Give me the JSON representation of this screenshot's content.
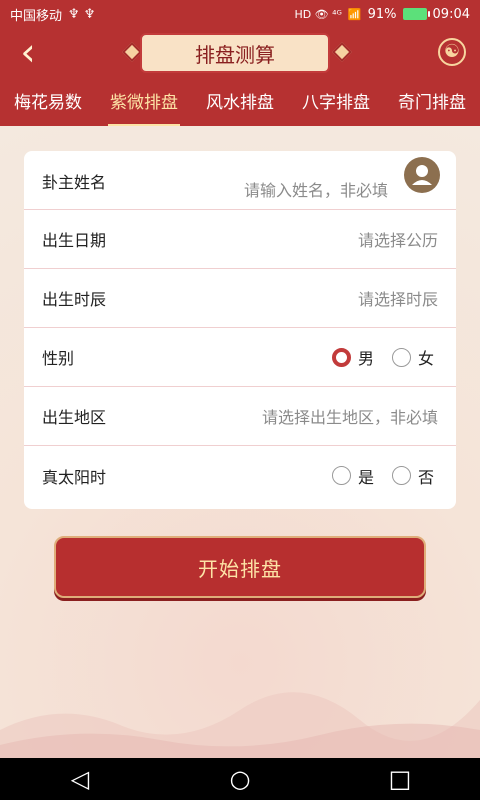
{
  "status_bar": {
    "carrier": "中国移动",
    "left_symbols": "♆ ♆",
    "right_symbols": "HD 👁 ⁴ᴳ",
    "signal": "📶",
    "battery_percent": "91%",
    "time": "09:04"
  },
  "header": {
    "title": "排盘测算"
  },
  "tabs": [
    {
      "label": "梅花易数"
    },
    {
      "label": "紫微排盘"
    },
    {
      "label": "风水排盘"
    },
    {
      "label": "八字排盘"
    },
    {
      "label": "奇门排盘"
    }
  ],
  "form": {
    "name_label": "卦主姓名",
    "name_placeholder": "请输入姓名，非必填",
    "birth_date_label": "出生日期",
    "birth_date_placeholder": "请选择公历",
    "birth_time_label": "出生时辰",
    "birth_time_placeholder": "请选择时辰",
    "gender_label": "性别",
    "gender_options": [
      "男",
      "女"
    ],
    "gender_selected": "男",
    "birth_place_label": "出生地区",
    "birth_place_placeholder": "请选择出生地区，非必填",
    "true_solar_label": "真太阳时",
    "true_solar_options": [
      "是",
      "否"
    ]
  },
  "button": {
    "start_label": "开始排盘"
  },
  "nav": {
    "back": "◁",
    "home": "○",
    "recents": "□"
  },
  "colors": {
    "brand_red": "#b63131",
    "accent_gold": "#fde3a6",
    "radio_checked": "#c23b3b"
  }
}
